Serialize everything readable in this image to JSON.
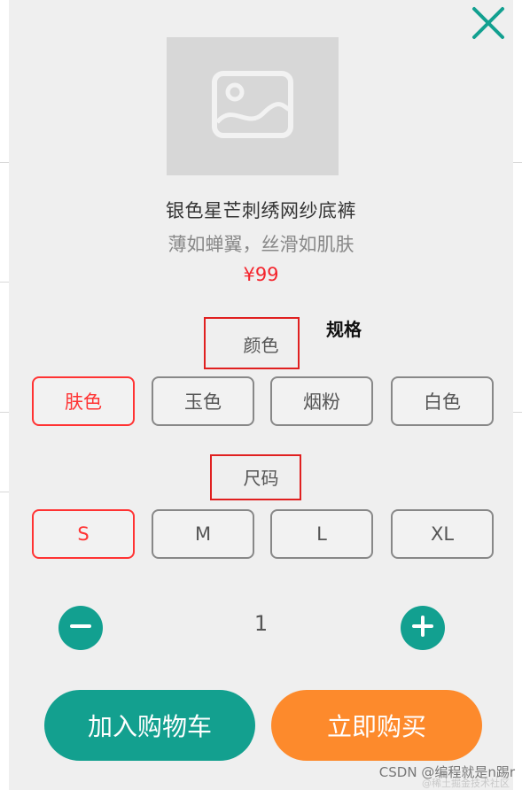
{
  "product": {
    "name": "银色星芒刺绣网纱底裤",
    "desc": "薄如蝉翼，丝滑如肌肤",
    "price": "¥99"
  },
  "annotation": {
    "label": "规格"
  },
  "color_section": {
    "title": "颜色",
    "options": [
      {
        "label": "肤色",
        "selected": true
      },
      {
        "label": "玉色",
        "selected": false
      },
      {
        "label": "烟粉",
        "selected": false
      },
      {
        "label": "白色",
        "selected": false
      }
    ]
  },
  "size_section": {
    "title": "尺码",
    "options": [
      {
        "label": "S",
        "selected": true
      },
      {
        "label": "M",
        "selected": false
      },
      {
        "label": "L",
        "selected": false
      },
      {
        "label": "XL",
        "selected": false
      }
    ]
  },
  "quantity": {
    "value": "1"
  },
  "actions": {
    "add_to_cart": "加入购物车",
    "buy_now": "立即购买"
  },
  "watermark": {
    "text": "CSDN @编程就是n踢r",
    "subtext": "@稀土掘金技术社区"
  },
  "colors": {
    "accent": "#13a08f",
    "buy": "#fd8a2c",
    "selected": "#ff3333",
    "price": "#f4242c",
    "highlight": "#e02020"
  },
  "icons": [
    "close-icon",
    "image-placeholder-icon",
    "minus-icon",
    "plus-icon"
  ]
}
